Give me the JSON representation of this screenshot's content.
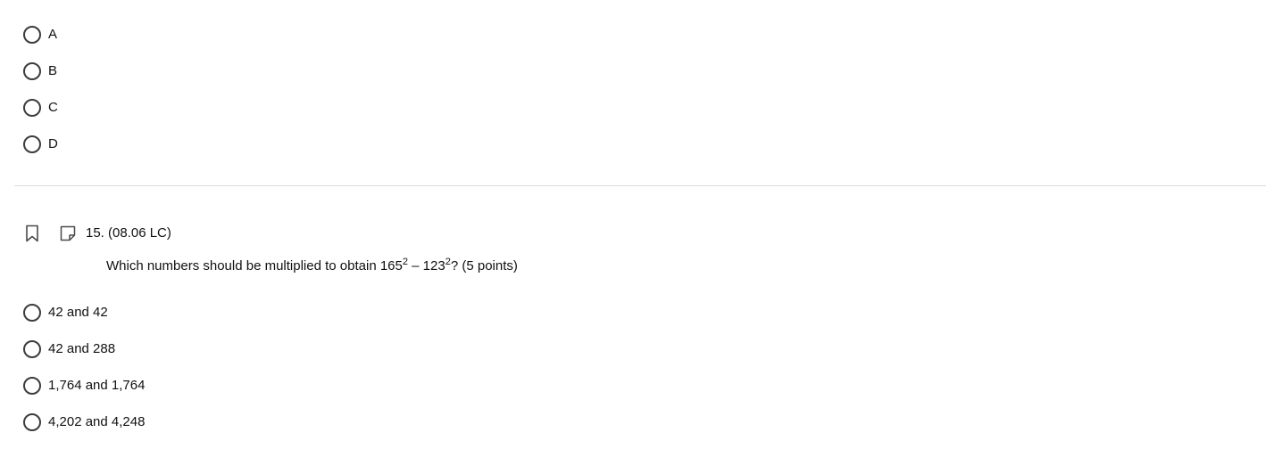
{
  "previous_question": {
    "options": [
      {
        "label": "A"
      },
      {
        "label": "B"
      },
      {
        "label": "C"
      },
      {
        "label": "D"
      }
    ]
  },
  "question": {
    "number": "15. (08.06 LC)",
    "icons": {
      "bookmark": "bookmark-icon",
      "note": "note-icon"
    },
    "prompt_before": "Which numbers should be multiplied to obtain 165",
    "exponent_1": "2",
    "prompt_middle": " – 123",
    "exponent_2": "2",
    "prompt_after": "? (5 points)",
    "options": [
      {
        "label": "42 and 42"
      },
      {
        "label": "42 and 288"
      },
      {
        "label": "1,764 and 1,764"
      },
      {
        "label": "4,202 and 4,248"
      }
    ]
  },
  "colors": {
    "text": "#111111",
    "radio_border": "#3c3c3c",
    "icon": "#4a4a4a",
    "divider": "#dcdcdc"
  }
}
